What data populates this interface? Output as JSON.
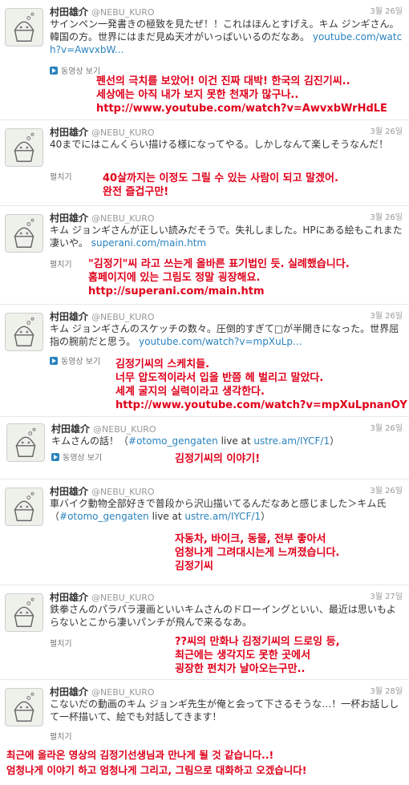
{
  "tweets": [
    {
      "name": "村田雄介",
      "handle": "@NEBU_KURO",
      "date": "3월 26일",
      "text": "サインペン一発書きの極致を見たぜ！！これはほんとすげえ。キム ジンギさん。韓国の方。世界にはまだ見ぬ天才がいっぱいいるのだなあ。",
      "link": "youtube.com/watch?v=AwvxbW...",
      "action": "동영상 보기",
      "translation": [
        "펜선의 극치를 보았어! 이건 진짜 대박! 한국의 김진기씨..",
        "세상에는 아직 내가 보지 못한 천재가 많구나..",
        "http://www.youtube.com/watch?v=AwvxbWrHdLE"
      ]
    },
    {
      "name": "村田雄介",
      "handle": "@NEBU_KURO",
      "date": "3월 26일",
      "text": "40までにはこんくらい描ける様になってやる。しかしなんて楽しそうなんだ！",
      "link": "",
      "action": "펼치기",
      "translation": [
        "40살까지는 이정도 그릴 수 있는 사람이 되고 말겠어.",
        "완전 즐겁구만!"
      ]
    },
    {
      "name": "村田雄介",
      "handle": "@NEBU_KURO",
      "date": "3월 26일",
      "text": "キム ジョンギさんが正しい読みだそうで。失礼しました。HPにある絵もこれまた凄いや。",
      "link": "superani.com/main.htm",
      "action": "펼치기",
      "translation": [
        "\"김정기\"씨 라고 쓰는게 올바른 표기법인 듯. 실례했습니다.",
        "홈페이지에 있는 그림도 정말 굉장해요.",
        "http://superani.com/main.htm"
      ]
    },
    {
      "name": "村田雄介",
      "handle": "@NEBU_KURO",
      "date": "3월 26일",
      "text": "キム ジョンギさんのスケッチの数々。圧倒的すぎて□が半開きになった。世界屈指の腕前だと思う。",
      "link": "youtube.com/watch?v=mpXuLp...",
      "action": "동영상 보기",
      "translation": [
        "김정기씨의 스케치들.",
        "너무 압도적이라서 입을 반쯤 헤 벌리고 말았다.",
        "세계 굴지의 실력이라고 생각한다.",
        "http://www.youtube.com/watch?v=mpXuLpnanOY"
      ]
    },
    {
      "name": "村田雄介",
      "handle": "@NEBU_KURO",
      "date": "3월 26일",
      "text": "キムさんの話！（",
      "link": "#otomo_gengaten",
      "text2": " live at ",
      "link2": "ustre.am/IYCF/1",
      "text3": "）",
      "action": "동영상 보기",
      "translation": [
        "김정기씨의 이야기!"
      ]
    },
    {
      "name": "村田雄介",
      "handle": "@NEBU_KURO",
      "date": "3월 26일",
      "text": "車バイク動物全部好きで普段から沢山描いてるんだなあと感じました＞キム氏（",
      "link": "#otomo_gengaten",
      "text2": " live at ",
      "link2": "ustre.am/IYCF/1",
      "text3": "）",
      "action": "",
      "translation": [
        "자동차, 바이크, 동물, 전부 좋아서",
        "엄청나게 그려대시는게 느껴졌습니다.",
        "김정기씨"
      ]
    },
    {
      "name": "村田雄介",
      "handle": "@NEBU_KURO",
      "date": "3월 27일",
      "text": "鉄拳さんのパラパラ漫画といいキムさんのドローイングといい、最近は思いもよらないとこから凄いパンチが飛んで来るなあ。",
      "link": "",
      "action": "펼치기",
      "translation": [
        "??씨의 만화나 김정기씨의 드로잉 등,",
        "최근에는 생각지도 못한 곳에서",
        "굉장한 펀치가 날아오는구만.."
      ]
    },
    {
      "name": "村田雄介",
      "handle": "@NEBU_KURO",
      "date": "3월 28일",
      "text": "こないだの動画のキム ジョンギ先生が俺と会って下さるそうな…！一杯お話しして一杯描いて、絵でも対話してきます！",
      "link": "",
      "action": "펼치기",
      "translation": [
        "최근에 올라온 영상의 김정기선생님과 만나게 될 것 같습니다..!",
        "엄청나게 이야기 하고 엄청나게 그리고, 그림으로 대화하고 오겠습니다!"
      ]
    }
  ]
}
